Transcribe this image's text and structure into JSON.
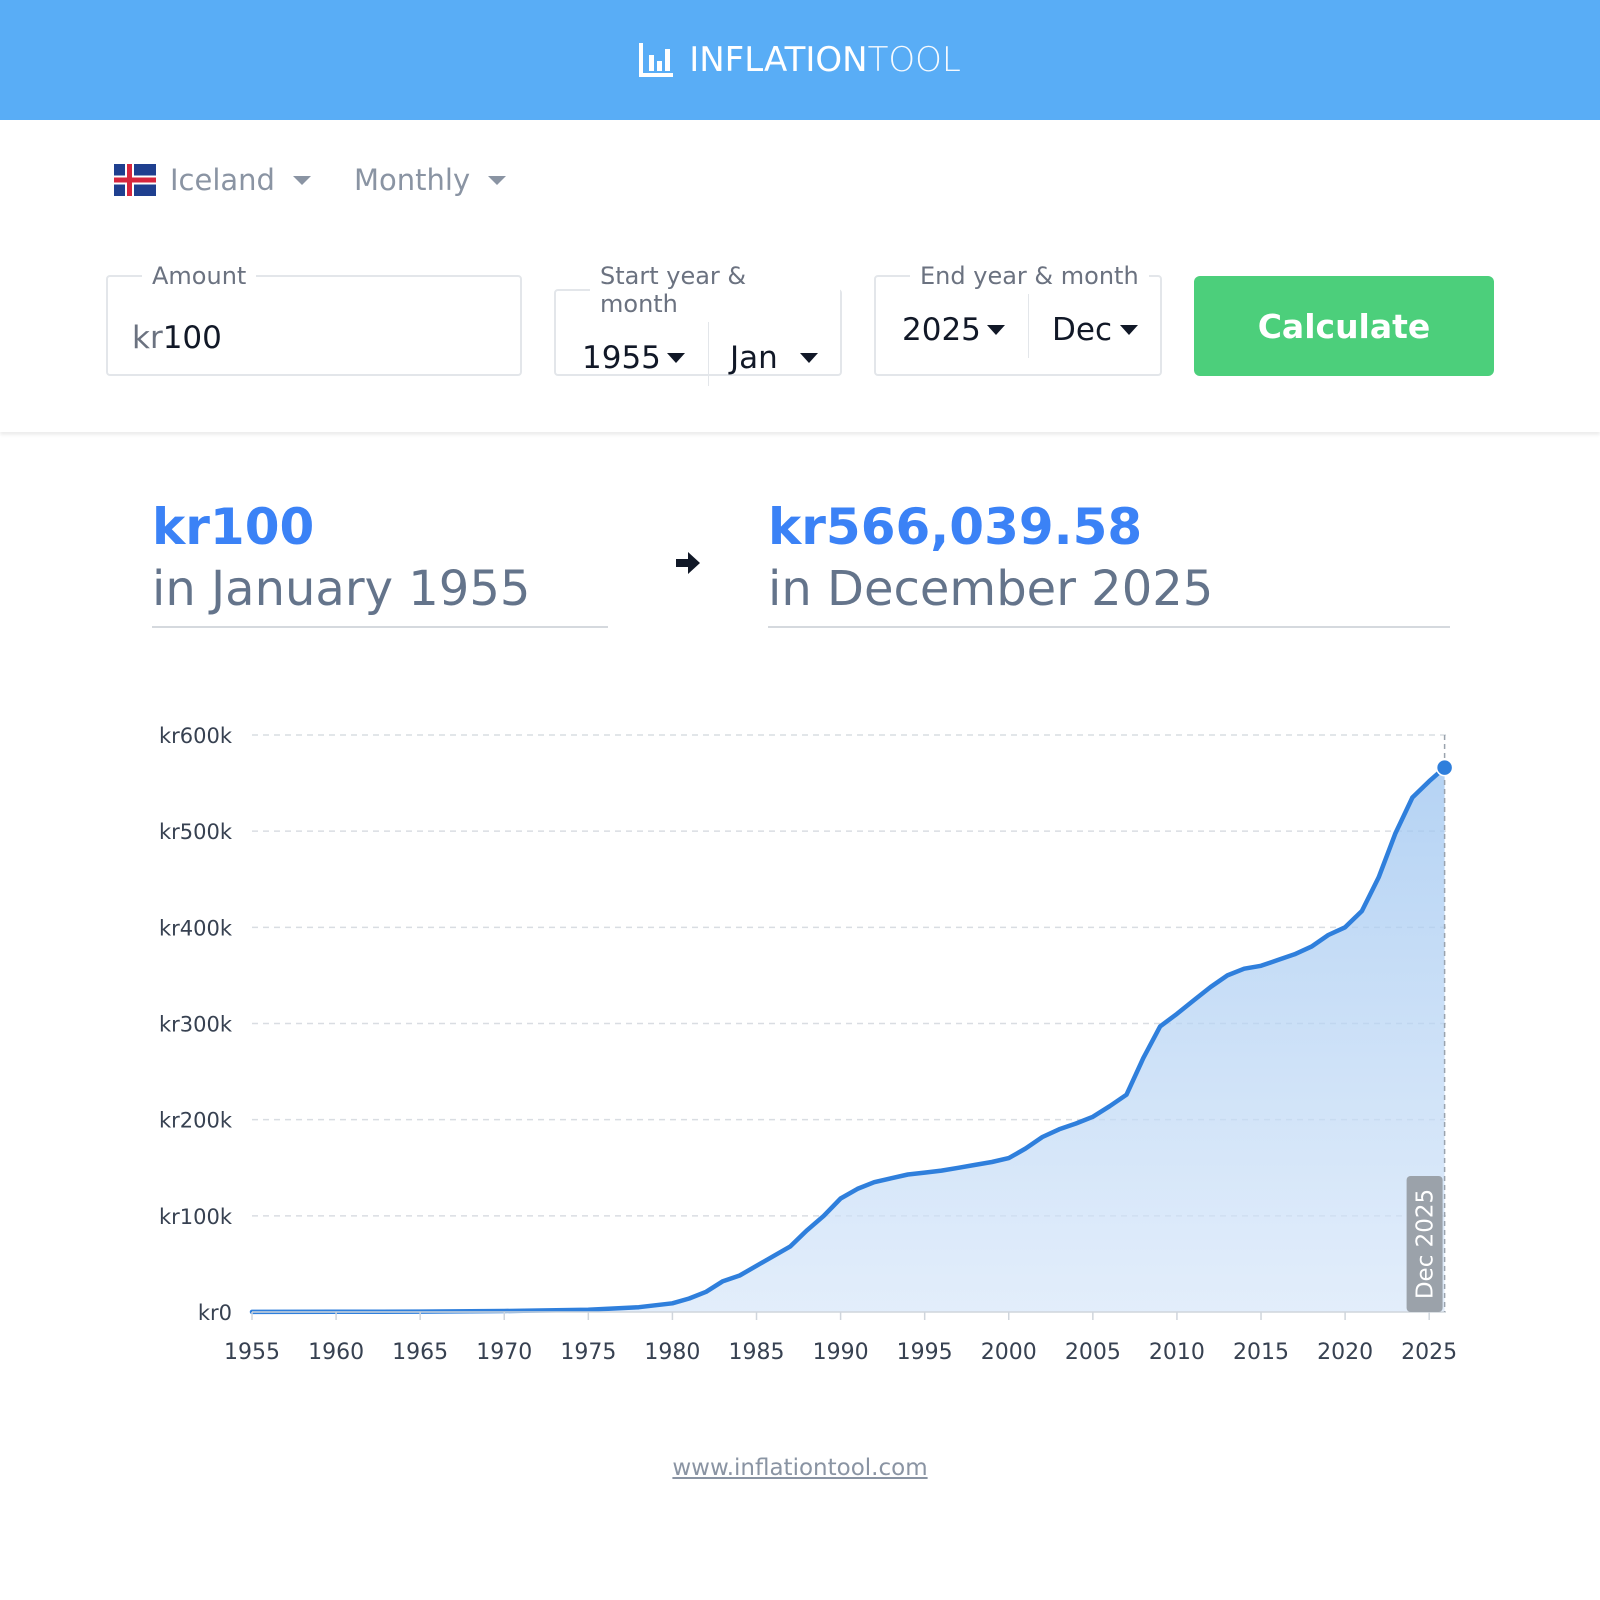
{
  "header": {
    "logo_icon": "bar-chart-icon",
    "logo_part1": "INFLATION",
    "logo_part2": "TOOL",
    "color": "#59adf6"
  },
  "controls": {
    "country": {
      "label": "Iceland",
      "flag_icon": "iceland-flag-icon"
    },
    "frequency": {
      "label": "Monthly"
    },
    "amount": {
      "legend": "Amount",
      "currency": "kr",
      "value": "100"
    },
    "start": {
      "legend": "Start year & month",
      "year": "1955",
      "month": "Jan"
    },
    "end": {
      "legend": "End year & month",
      "year": "2025",
      "month": "Dec"
    },
    "calculate_label": "Calculate",
    "calculate_color": "#4ccf7b"
  },
  "result": {
    "from_amount": "kr100",
    "from_date": "in January 1955",
    "to_amount": "kr566,039.58",
    "to_date": "in December 2025",
    "arrow_icon": "arrow-right-icon",
    "accent": "#3b82f6"
  },
  "chart_data": {
    "type": "area",
    "title": "",
    "xlabel": "",
    "ylabel": "",
    "x_ticks": [
      "1955",
      "1960",
      "1965",
      "1970",
      "1975",
      "1980",
      "1985",
      "1990",
      "1995",
      "2000",
      "2005",
      "2010",
      "2015",
      "2020",
      "2025"
    ],
    "y_ticks": [
      "kr0",
      "kr100k",
      "kr200k",
      "kr300k",
      "kr400k",
      "kr500k",
      "kr600k"
    ],
    "xlim": [
      1955,
      2026
    ],
    "ylim": [
      0,
      600000
    ],
    "grid": true,
    "line_color": "#2f7fdc",
    "marker_label": "Dec 2025",
    "series": [
      {
        "x": [
          1955,
          1960,
          1965,
          1970,
          1975,
          1978,
          1980,
          1981,
          1982,
          1983,
          1984,
          1985,
          1986,
          1987,
          1988,
          1989,
          1990,
          1991,
          1992,
          1993,
          1994,
          1995,
          1996,
          1997,
          1998,
          1999,
          2000,
          2001,
          2002,
          2003,
          2004,
          2005,
          2006,
          2007,
          2008,
          2009,
          2010,
          2011,
          2012,
          2013,
          2014,
          2015,
          2016,
          2017,
          2018,
          2019,
          2020,
          2021,
          2022,
          2023,
          2024,
          2025,
          2025.917
        ],
        "y": [
          100,
          180,
          400,
          1000,
          2300,
          5000,
          9000,
          14000,
          21000,
          32000,
          38000,
          48000,
          58000,
          68000,
          85000,
          100000,
          118000,
          128000,
          135000,
          139000,
          143000,
          145000,
          147000,
          150000,
          153000,
          156000,
          160000,
          170000,
          182000,
          190000,
          196000,
          203000,
          214000,
          226000,
          264000,
          297000,
          310000,
          324000,
          338000,
          350000,
          357000,
          360000,
          366000,
          372000,
          380000,
          392000,
          400000,
          417000,
          452000,
          498000,
          535000,
          552000,
          566039.58
        ]
      }
    ]
  },
  "footer": {
    "link": "www.inflationtool.com"
  }
}
